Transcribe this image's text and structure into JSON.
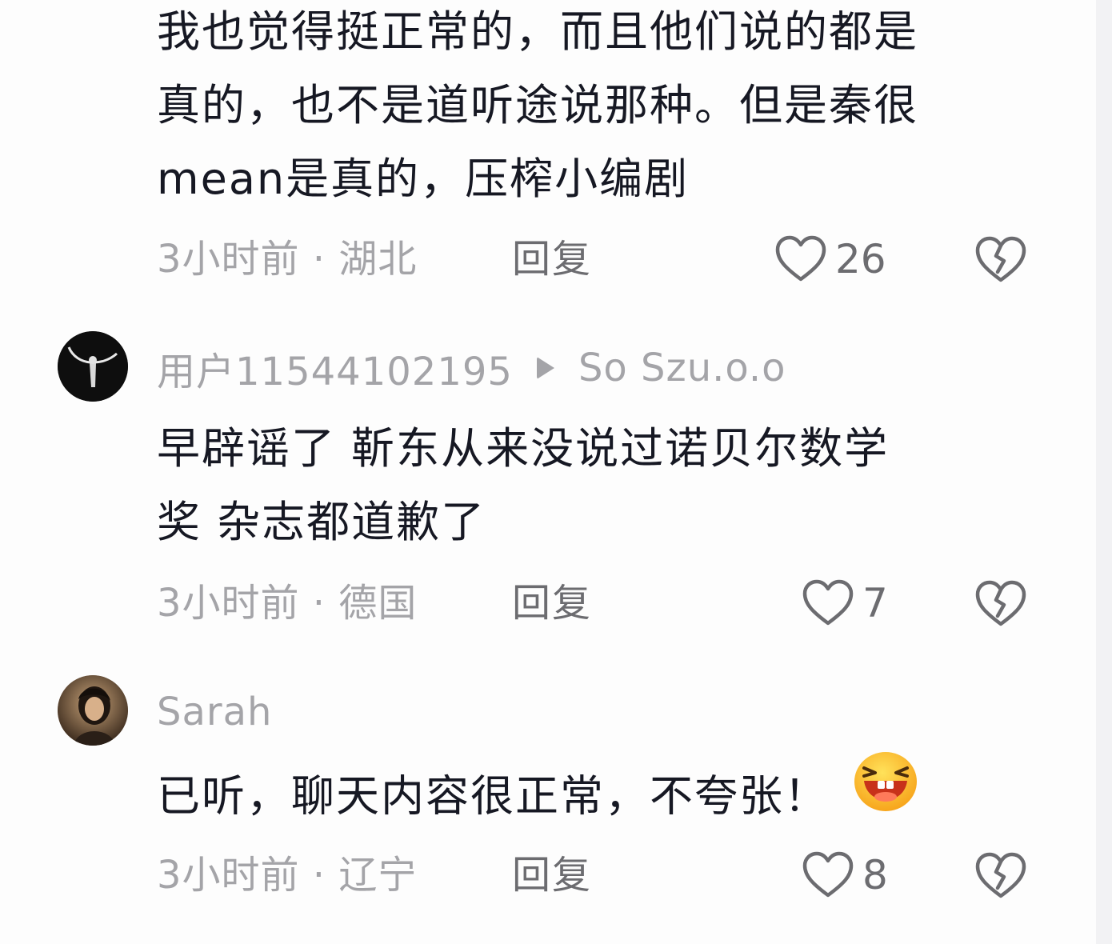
{
  "comments": [
    {
      "text_lines": [
        "我也觉得挺正常的，而且他们说的都是",
        "真的，也不是道听途说那种。但是秦很",
        "mean是真的，压榨小编剧"
      ],
      "time_location": "3小时前 · 湖北",
      "reply_label": "回复",
      "like_count": "26",
      "icons": {
        "like": "heart-outline-icon",
        "dislike": "broken-heart-icon"
      }
    },
    {
      "username": "用户11544102195",
      "reply_to": "So Szu.o.o",
      "avatar_icon": "avatar-dark-figure",
      "text_lines": [
        "早辟谣了 靳东从来没说过诺贝尔数学",
        "奖 杂志都道歉了"
      ],
      "time_location": "3小时前 · 德国",
      "reply_label": "回复",
      "like_count": "7",
      "icons": {
        "like": "heart-outline-icon",
        "dislike": "broken-heart-icon"
      }
    },
    {
      "username": "Sarah",
      "avatar_icon": "avatar-photo-portrait",
      "text": "已听，聊天内容很正常，不夸张！",
      "emoji": "grinning-squint-emoji",
      "time_location": "3小时前 · 辽宁",
      "reply_label": "回复",
      "like_count": "8",
      "icons": {
        "like": "heart-outline-icon",
        "dislike": "broken-heart-icon"
      }
    }
  ],
  "colors": {
    "text_primary": "#161823",
    "text_secondary": "#a4a4a8",
    "icon_gray": "#6c6c70",
    "background": "#fdfdfd"
  }
}
